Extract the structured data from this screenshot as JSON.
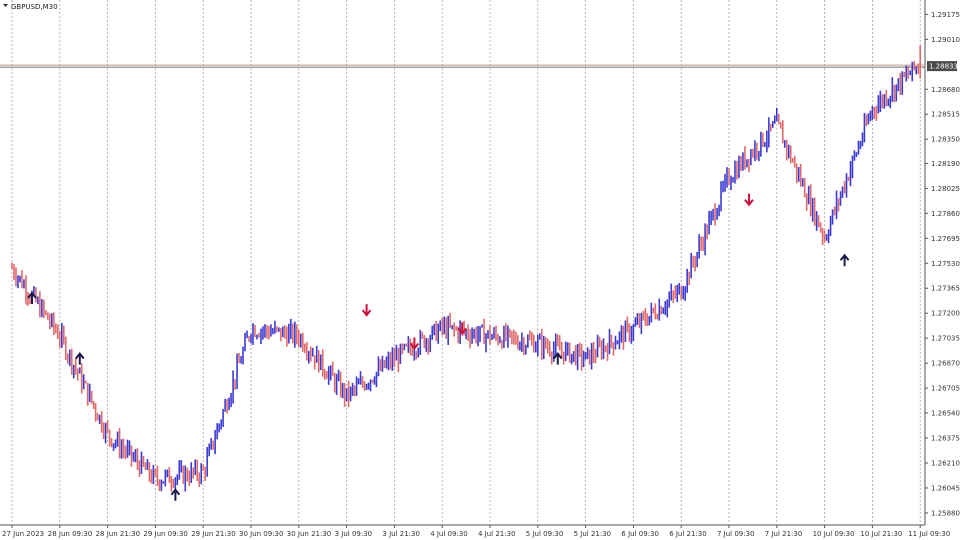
{
  "window": {
    "symbol_label": "GBPUSD,M30"
  },
  "colors": {
    "bull": "#3b3bd4",
    "bear": "#e06a6a",
    "grid": "#9a9a9a",
    "price_line": "#c89a82",
    "price_box": "#4a4a4a",
    "arrow_up": "#1a1a4a",
    "arrow_down": "#d0103a"
  },
  "chart_data": {
    "type": "line",
    "title": "GBPUSD,M30",
    "xlabel": "",
    "ylabel": "",
    "grid": true,
    "ylim": [
      1.258,
      1.2927
    ],
    "y_ticks": [
      "1.29175",
      "1.29010",
      "1.28680",
      "1.28515",
      "1.28350",
      "1.28190",
      "1.28025",
      "1.27860",
      "1.27695",
      "1.27530",
      "1.27365",
      "1.27200",
      "1.27035",
      "1.26870",
      "1.26705",
      "1.26540",
      "1.26375",
      "1.26210",
      "1.26045",
      "1.25880"
    ],
    "x_ticks": [
      "27 Jun 2023",
      "28 Jun 09:30",
      "28 Jun 21:30",
      "29 Jun 09:30",
      "29 Jun 21:30",
      "30 Jun 09:30",
      "30 Jun 21:30",
      "3 Jul 09:30",
      "3 Jul 21:30",
      "4 Jul 09:30",
      "4 Jul 21:30",
      "5 Jul 09:30",
      "5 Jul 21:30",
      "6 Jul 09:30",
      "6 Jul 21:30",
      "7 Jul 09:30",
      "7 Jul 21:30",
      "10 Jul 09:30",
      "10 Jul 21:30",
      "11 Jul 09:30"
    ],
    "current_price": "1.28833",
    "series": [
      {
        "x": [
          "27 Jun 2023",
          "28 Jun 09:30",
          "28 Jun 21:30",
          "29 Jun 09:30",
          "29 Jun 21:30",
          "30 Jun 09:30",
          "30 Jun 21:30",
          "3 Jul 09:30",
          "3 Jul 21:30",
          "4 Jul 09:30",
          "4 Jul 21:30",
          "5 Jul 09:30",
          "5 Jul 21:30",
          "6 Jul 09:30",
          "6 Jul 21:30",
          "7 Jul 09:30",
          "7 Jul 21:30",
          "10 Jul 09:30",
          "10 Jul 21:30",
          "11 Jul 09:30"
        ],
        "values": [
          1.275,
          1.2705,
          1.264,
          1.261,
          1.2615,
          1.271,
          1.2705,
          1.2665,
          1.269,
          1.271,
          1.2705,
          1.27,
          1.269,
          1.271,
          1.2735,
          1.281,
          1.2845,
          1.277,
          1.2855,
          1.2885
        ]
      }
    ],
    "arrows": [
      {
        "x": "27 Jun 2023",
        "y": 1.273,
        "direction": "up"
      },
      {
        "x": "28 Jun 09:30",
        "y": 1.269,
        "direction": "up"
      },
      {
        "x": "29 Jun 09:30",
        "y": 1.26,
        "direction": "up"
      },
      {
        "x": "3 Jul 09:30",
        "y": 1.2722,
        "direction": "down"
      },
      {
        "x": "3 Jul 21:30",
        "y": 1.27,
        "direction": "down"
      },
      {
        "x": "4 Jul 09:30",
        "y": 1.271,
        "direction": "down"
      },
      {
        "x": "5 Jul 09:30",
        "y": 1.269,
        "direction": "up"
      },
      {
        "x": "7 Jul 09:30",
        "y": 1.2795,
        "direction": "down"
      },
      {
        "x": "10 Jul 09:30",
        "y": 1.2755,
        "direction": "up"
      }
    ]
  }
}
